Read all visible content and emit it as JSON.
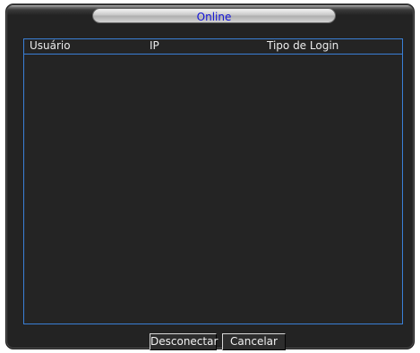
{
  "window": {
    "title": "Online"
  },
  "table": {
    "columns": [
      "Usuário",
      "IP",
      "Tipo de Login"
    ],
    "rows": []
  },
  "buttons": {
    "disconnect": "Desconectar",
    "cancel": "Cancelar"
  },
  "colors": {
    "title_text": "#1313d8",
    "panel_border": "#3a7fd6",
    "panel_bg": "#242424"
  }
}
